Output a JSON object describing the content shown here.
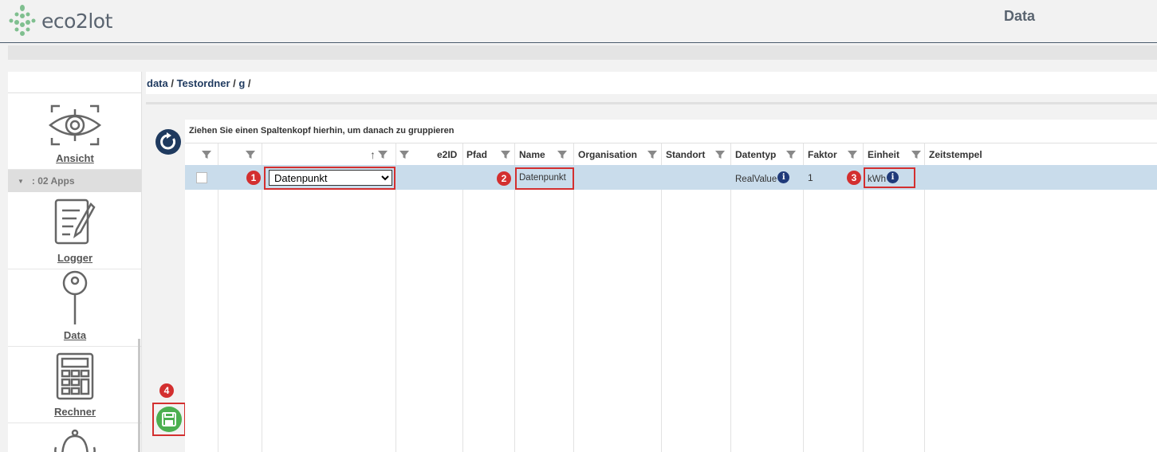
{
  "app": {
    "logo_text": "eco2lot",
    "title": "Data"
  },
  "sidebar": {
    "items": [
      {
        "label": "Ansicht",
        "icon": "eye-scan-icon"
      },
      {
        "label": "Logger",
        "icon": "document-edit-icon"
      },
      {
        "label": "Data",
        "icon": "pin-icon"
      },
      {
        "label": "Rechner",
        "icon": "calculator-icon"
      },
      {
        "label": "",
        "icon": "alarm-bell-icon"
      }
    ],
    "group_label": ": 02 Apps"
  },
  "breadcrumb": {
    "parts": [
      "data",
      "Testordner",
      "g"
    ],
    "sep": " / "
  },
  "grid": {
    "group_hint": "Ziehen Sie einen Spaltenkopf hierhin, um danach zu gruppieren",
    "columns": [
      "e2ID",
      "Pfad",
      "Name",
      "Organisation",
      "Standort",
      "Datentyp",
      "Faktor",
      "Einheit",
      "Zeitstempel"
    ],
    "row": {
      "type_select": "Datenpunkt",
      "name": "Datenpunkt",
      "datatype": "RealValue",
      "factor": "1",
      "unit": "kWh"
    }
  },
  "annotations": [
    "1",
    "2",
    "3",
    "4"
  ],
  "colors": {
    "accent": "#1f3a5f",
    "highlight": "#d32f2f",
    "row": "#c9dceb",
    "save": "#4caf50"
  }
}
